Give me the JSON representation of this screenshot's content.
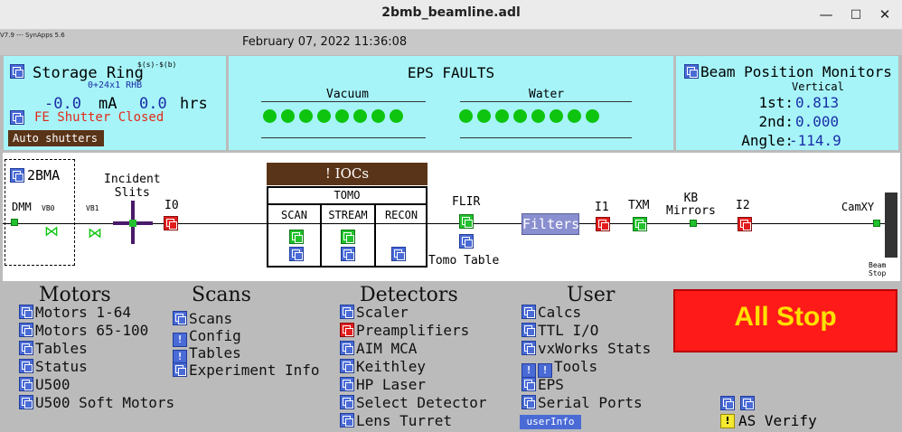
{
  "window": {
    "title": "2bmb_beamline.adl"
  },
  "header": {
    "version": "V7.9 --- SynApps 5.6",
    "datetime": "February 07, 2022 11:36:08"
  },
  "storage_ring": {
    "title": "Storage Ring",
    "formula": "$(s)-$(b)",
    "fill": "0+24x1 RHB",
    "current": "-0.0",
    "current_unit": "mA",
    "lifetime": "0.0",
    "lifetime_unit": "hrs",
    "shutter": "FE Shutter Closed",
    "auto_shutters": "Auto shutters"
  },
  "eps": {
    "title": "EPS FAULTS",
    "vacuum_label": "Vacuum",
    "water_label": "Water",
    "vacuum_leds": 8,
    "water_leds": 8,
    "led_color": "#0ec40e"
  },
  "bpm": {
    "title": "Beam Position Monitors",
    "vertical": "Vertical",
    "first_label": "1st:",
    "first_value": "0.813",
    "second_label": "2nd:",
    "second_value": "0.000",
    "angle_label": "Angle:",
    "angle_value": "-114.9"
  },
  "beamline": {
    "station": "2BMA",
    "dmm": "DMM",
    "vb0": "VB0",
    "vb1": "VB1",
    "incident_slits": "Incident\nSlits",
    "i0": "I0",
    "iocs_button": "! IOCs",
    "tomo": "TOMO",
    "scan": "SCAN",
    "stream": "STREAM",
    "recon": "RECON",
    "flir": "FLIR",
    "tomo_table": "Tomo Table",
    "filters": "Filters",
    "i1": "I1",
    "txm": "TXM",
    "kb_mirrors": "KB\nMirrors",
    "i2": "I2",
    "camxy": "CamXY",
    "beam_stop": "Beam\nStop"
  },
  "menus": {
    "motors": {
      "title": "Motors",
      "items": [
        "Motors 1-64",
        "Motors 65-100",
        "Tables",
        "Status",
        "U500",
        "U500 Soft Motors"
      ]
    },
    "scans": {
      "title": "Scans",
      "items": [
        "Scans",
        "Config",
        "Tables",
        "Experiment Info"
      ]
    },
    "detectors": {
      "title": "Detectors",
      "items": [
        "Scaler",
        "Preamplifiers",
        "AIM MCA",
        "Keithley",
        "HP Laser",
        "Select Detector",
        "Lens Turret"
      ]
    },
    "user": {
      "title": "User",
      "items": [
        "Calcs",
        "TTL I/O",
        "vxWorks Stats",
        "Tools",
        "EPS",
        "Serial Ports"
      ],
      "userinfo": "userInfo"
    }
  },
  "all_stop": {
    "label": "All Stop",
    "color": "#ff1a1a",
    "text_color": "#ffe000"
  },
  "as_verify": "AS Verify",
  "colors": {
    "panel_cyan": "#a6f4f8",
    "accent_blue": "#4a6bd6",
    "brown": "#5a3418",
    "filters_bg": "#8a8fd0"
  }
}
